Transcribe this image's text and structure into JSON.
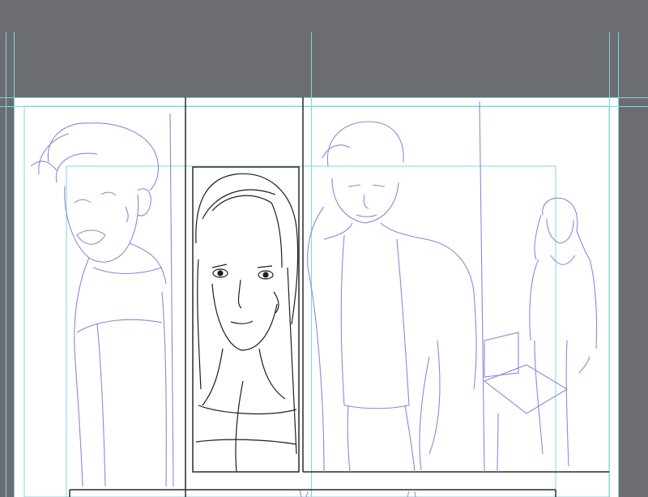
{
  "document": {
    "type": "manga-storyboard-canvas",
    "panels": [
      {
        "id": "panel-1",
        "content": "laughing-young-man-sketch",
        "stage": "rough-pencil"
      },
      {
        "id": "panel-2",
        "content": "woman-closeup-inked",
        "stage": "inked"
      },
      {
        "id": "panel-3",
        "content": "man-in-jacket-with-woman-background",
        "stage": "rough-pencil"
      },
      {
        "id": "panel-4",
        "content": "bottom-strip",
        "stage": "partial"
      }
    ]
  },
  "colors": {
    "canvas_background": "#6b6d70",
    "paper": "#ffffff",
    "guide_lines": "#7fd6e0",
    "pencil_sketch": "#8c86e0",
    "ink": "#1e1e1e"
  }
}
